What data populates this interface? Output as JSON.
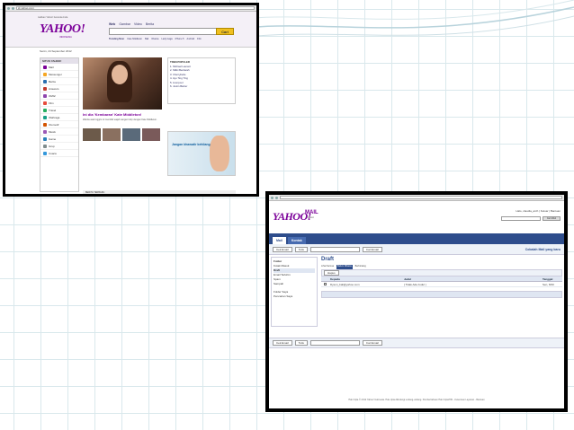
{
  "window1": {
    "url": "id.yahoo.com",
    "top_links": "Jadikan Yahoo! beranda Anda",
    "logo": "YAHOO!",
    "logo_sub": "INDONESIA",
    "tabs": [
      "Web",
      "Gambar",
      "Video",
      "Berita"
    ],
    "search_button": "Cari",
    "links": [
      "Trending Now:",
      "Kate Middleton",
      "Bali",
      "Obama",
      "Lady Gaga",
      "iPhone 5",
      "Android",
      "Film"
    ],
    "date": "Senin, 24 September 2012",
    "left_header": "SITUS YAHOO!",
    "left_items": [
      "Mail",
      "Messenger",
      "Berita",
      "Answers",
      "OMG!",
      "Film",
      "Travel",
      "Olahraga",
      "Otomotif",
      "Musik",
      "Game",
      "Grup",
      "Cuaca"
    ],
    "headline": "Ini dia 'Kembaran' Kate Middleton!",
    "headline_text": "Wanita asal Inggris ini memiliki wajah sangat mirip dengan Kate Middleton.",
    "trend_header": "TREN POPULER",
    "trends": [
      "1. Michael Laurent",
      "2. Miliki Berdarah",
      "3. Cherrybelle",
      "4. Ayu Ting Ting",
      "5. Liverpool",
      "6. Justin Bieber"
    ],
    "ad_text": "Jangan khawatir kehilangan rambut",
    "bottom": "BERITA TERBARU"
  },
  "window2": {
    "logo": "YAHOO!",
    "mail": "MAIL",
    "beta": "Classic",
    "user_bar": "Halo, claudia_arch | Keluar | Bantuan",
    "search_btn": "Cari Web",
    "tabs": [
      "Mail",
      "Kontak"
    ],
    "account": "Apa yang baru? - Mail & Ponsel",
    "account2": "Cobalah Mail yang baru",
    "tool_buttons": [
      "Cek Email",
      "Tulis"
    ],
    "search_btn2": "Cari Email",
    "side_header": "Folder",
    "side_items": [
      "Kotak Masuk",
      "Draft",
      "Email Terkirim",
      "Spam",
      "Sampah",
      "Folder Saya",
      "Pencarian Saya"
    ],
    "title": "Draft",
    "sub": [
      "Lihat Semua",
      "Belum Dibaca",
      "Berbintang"
    ],
    "act": [
      "Hapus"
    ],
    "cols": [
      "",
      "Kepada",
      "Judul",
      "Tanggal"
    ],
    "rows": [
      [
        "",
        "Dyson_bali@yahoo.com",
        "[ Tidak Ada Judul ]",
        "Sen, 8/20"
      ]
    ],
    "footer": "Hak Cipta © 2012 Yahoo! Indonesia. Hak cipta dilindungi undang-undang. Pemberitahuan Hak Cipta/HKI - Ketentuan Layanan - Bantuan"
  },
  "colors": {
    "yahoo_purple": "#7b0099",
    "mail_blue": "#2e4d8c"
  }
}
